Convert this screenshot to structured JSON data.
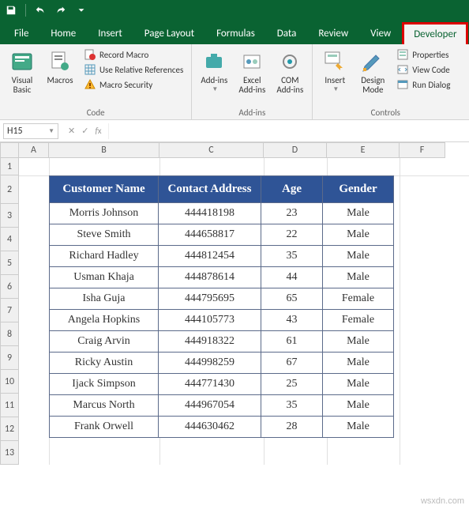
{
  "titlebar": {
    "icons": [
      "save",
      "undo",
      "redo",
      "dropdown"
    ]
  },
  "tabs": [
    "File",
    "Home",
    "Insert",
    "Page Layout",
    "Formulas",
    "Data",
    "Review",
    "View",
    "Developer"
  ],
  "active_tab": "Developer",
  "ribbon": {
    "code": {
      "visual_basic": "Visual Basic",
      "macros": "Macros",
      "record": "Record Macro",
      "relative": "Use Relative References",
      "security": "Macro Security",
      "label": "Code"
    },
    "addins": {
      "addins": "Add-ins",
      "excel": "Excel Add-ins",
      "com": "COM Add-ins",
      "label": "Add-ins"
    },
    "controls": {
      "insert": "Insert",
      "design": "Design Mode",
      "properties": "Properties",
      "view_code": "View Code",
      "run_dialog": "Run Dialog",
      "label": "Controls"
    }
  },
  "namebox": "H15",
  "columns": [
    "A",
    "B",
    "C",
    "D",
    "E",
    "F"
  ],
  "row_numbers": [
    1,
    2,
    3,
    4,
    5,
    6,
    7,
    8,
    9,
    10,
    11,
    12,
    13
  ],
  "table": {
    "headers": [
      "Customer Name",
      "Contact Address",
      "Age",
      "Gender"
    ],
    "rows": [
      [
        "Morris Johnson",
        "444418198",
        "23",
        "Male"
      ],
      [
        "Steve Smith",
        "444658817",
        "22",
        "Male"
      ],
      [
        "Richard Hadley",
        "444812454",
        "35",
        "Male"
      ],
      [
        "Usman Khaja",
        "444878614",
        "44",
        "Male"
      ],
      [
        "Isha Guja",
        "444795695",
        "65",
        "Female"
      ],
      [
        "Angela Hopkins",
        "444105773",
        "43",
        "Female"
      ],
      [
        "Craig Arvin",
        "444918322",
        "61",
        "Male"
      ],
      [
        "Ricky Austin",
        "444998259",
        "67",
        "Male"
      ],
      [
        "Ijack Simpson",
        "444771430",
        "25",
        "Male"
      ],
      [
        "Marcus North",
        "444967054",
        "35",
        "Male"
      ],
      [
        "Frank Orwell",
        "444630462",
        "28",
        "Male"
      ]
    ]
  },
  "watermark": "wsxdn.com"
}
